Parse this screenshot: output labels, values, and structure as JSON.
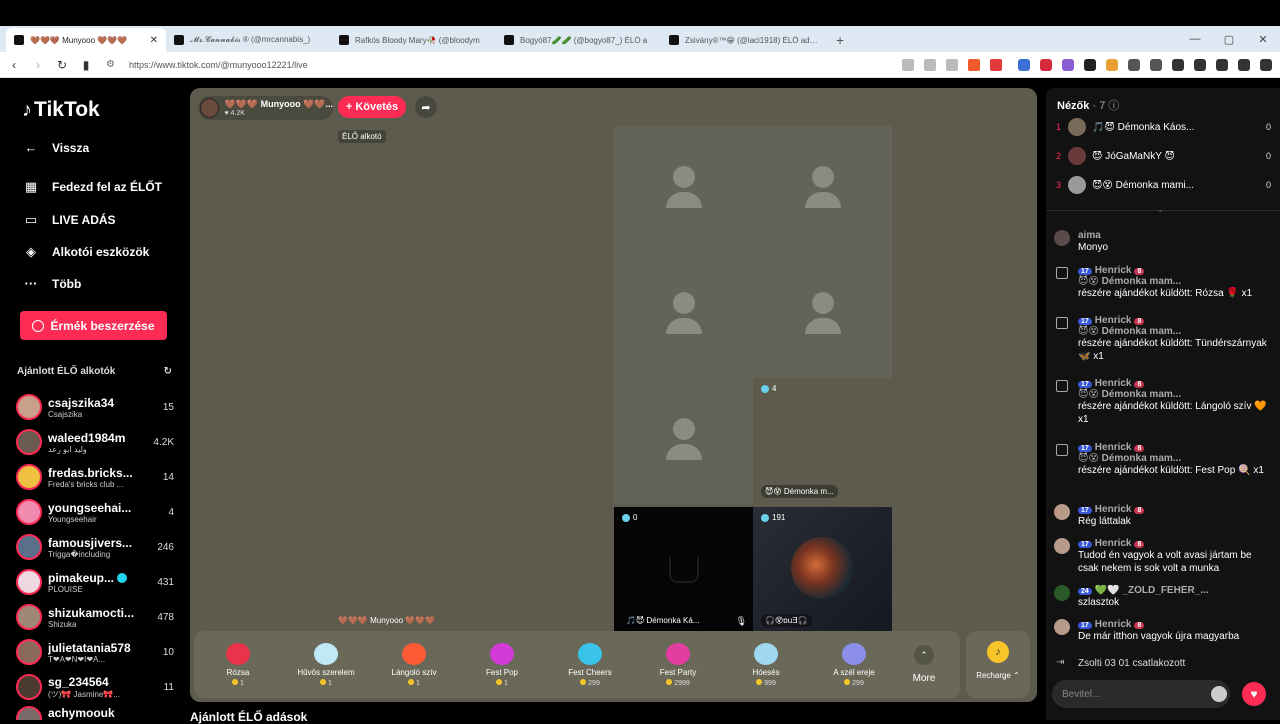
{
  "browser": {
    "tabs": [
      {
        "title": "🤎🤎🤎 Munyooo 🤎🤎🤎"
      },
      {
        "title": "𝓜𝓻.𝓒𝓪𝓷𝓷𝓪𝓫𝓲𝓼 ® (@mrcannabis_)"
      },
      {
        "title": "Rafkós Bloody Mary🥀 (@bloodym"
      },
      {
        "title": "Bogyó87🥒🥒 (@bogyo87_) ÉLŐ a"
      },
      {
        "title": "Zsivány®™😁 (@laci1918) ÉLŐ adás"
      }
    ],
    "new_tab": "+",
    "url": "https://www.tiktok.com/@munyooo12221/live"
  },
  "sidebar": {
    "logo": "TikTok",
    "back": "Vissza",
    "menu": [
      {
        "label": "Fedezd fel az ÉLŐT",
        "icon": "calendar-icon"
      },
      {
        "label": "LIVE ADÁS",
        "icon": "camera-icon"
      },
      {
        "label": "Alkotói eszközök",
        "icon": "creator-tools-icon"
      },
      {
        "label": "Több",
        "icon": "more-icon"
      }
    ],
    "coins_button": "Érmék beszerzése",
    "recommended_title": "Ajánlott ÉLŐ alkotók",
    "creators": [
      {
        "name": "csajszika34",
        "sub": "Csajszika",
        "count": "15"
      },
      {
        "name": "waleed1984m",
        "sub": "وليد ابو رعد",
        "count": "4.2K"
      },
      {
        "name": "fredas.bricks...",
        "sub": "Freda's bricks club ...",
        "count": "14"
      },
      {
        "name": "youngseehai...",
        "sub": "Youngseehair",
        "count": "4"
      },
      {
        "name": "famousjivers...",
        "sub": "Trigga�including",
        "count": "246"
      },
      {
        "name": "pimakeup...",
        "sub": "PLOUISE",
        "count": "431"
      },
      {
        "name": "shizukamocti...",
        "sub": "Shizuka",
        "count": "478"
      },
      {
        "name": "julietatania578",
        "sub": "T❤A❤N❤I❤A...",
        "count": "10"
      },
      {
        "name": "sg_234564",
        "sub": "(ツ)🎀 Jasmine🎀...",
        "count": "11"
      },
      {
        "name": "achymoouk",
        "sub": "",
        "count": ""
      }
    ]
  },
  "stage": {
    "host_name": "🤎🤎🤎 Munyooo 🤎🤎...",
    "host_likes": "♥ 4.2K",
    "follow": "+ Követés",
    "live_tooltip": "ÉLŐ alkotó",
    "host_label": "🤎🤎🤎 Munyooo 🤎🤎🤎",
    "guests": [
      {
        "count": "4",
        "name": "😈😵 Démonka m..."
      },
      {
        "count": "0",
        "name": "🎵😈 Démonka Ká..."
      },
      {
        "count": "191",
        "name": "🎧😵ɒuƎ🎧"
      }
    ],
    "gifts": [
      {
        "name": "Rózsa",
        "price": "1",
        "color": "#e8334a"
      },
      {
        "name": "Hűvös szerelem",
        "price": "1",
        "color": "#bfe9f6"
      },
      {
        "name": "Lángoló szív",
        "price": "1",
        "color": "#ff5a36"
      },
      {
        "name": "Fest Pop",
        "price": "1",
        "color": "#d23bd6"
      },
      {
        "name": "Fest Cheers",
        "price": "299",
        "color": "#3ac3e8"
      },
      {
        "name": "Fest Party",
        "price": "2999",
        "color": "#e23ea0"
      },
      {
        "name": "Hóesés",
        "price": "999",
        "color": "#9fd8ef"
      },
      {
        "name": "A szél ereje",
        "price": "299",
        "color": "#8b8fea"
      }
    ],
    "more": "More",
    "recharge": "Recharge ⌃",
    "below_title": "Ajánlott ÉLŐ adások"
  },
  "viewers": {
    "title": "Nézők",
    "count": "· 7",
    "list": [
      {
        "rank": "1",
        "name": "🎵😈 Démonka Káos...",
        "score": "0"
      },
      {
        "rank": "2",
        "name": "😈 JóGaMaNkY 😈",
        "score": "0"
      },
      {
        "rank": "3",
        "name": "😈😵 Démonka mami...",
        "score": "0"
      }
    ]
  },
  "chat": {
    "messages": [
      {
        "name": "aima",
        "text": "Monyo"
      },
      {
        "name": "Henrick",
        "level": "17",
        "fan": "8",
        "line": "😈😵 Démonka mam...",
        "text": "részére ajándékot küldött: Rózsa 🌹 x1"
      },
      {
        "name": "Henrick",
        "level": "17",
        "fan": "8",
        "line": "😈😵 Démonka mam...",
        "text": "részére ajándékot küldött: Tündérszárnyak 🦋 x1"
      },
      {
        "name": "Henrick",
        "level": "17",
        "fan": "8",
        "line": "😈😵 Démonka mam...",
        "text": "részére ajándékot küldött: Lángoló szív 🧡 x1"
      },
      {
        "name": "Henrick",
        "level": "17",
        "fan": "8",
        "line": "😈😵 Démonka mam...",
        "text": "részére ajándékot küldött: Fest Pop 🍭 x1"
      },
      {
        "name": "Henrick",
        "level": "17",
        "fan": "8",
        "text": "Rég láttalak"
      },
      {
        "name": "Henrick",
        "level": "17",
        "fan": "8",
        "text": "Tudod én vagyok a volt avasi jártam be csak nekem is sok volt a munka"
      },
      {
        "name": "💚🤍 _ZÖLD_FEHÉR_...",
        "level": "24",
        "text": "szlasztok"
      },
      {
        "name": "Henrick",
        "level": "17",
        "fan": "8",
        "text": "De már itthon vagyok újra magyarba"
      }
    ],
    "join": "Zsolti 03 01   csatlakozott",
    "input_placeholder": "Bevitel..."
  }
}
